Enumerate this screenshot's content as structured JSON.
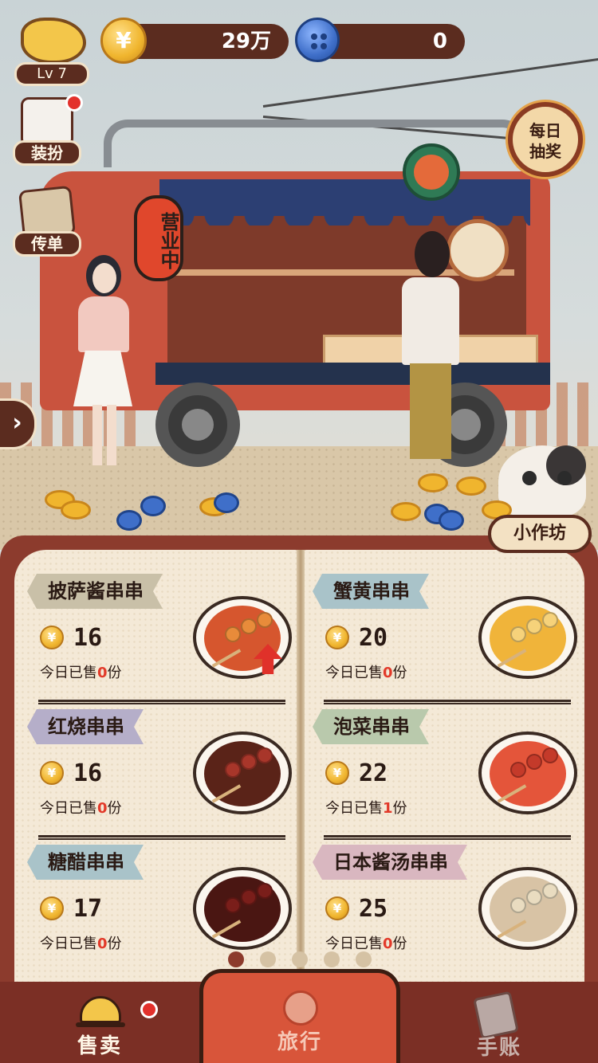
{
  "hud": {
    "level": "Lv 7",
    "coin_symbol": "¥",
    "coins": "29万",
    "buttons": "0"
  },
  "side": {
    "dress_up": "装扮",
    "flyer": "传单",
    "daily_lottery_line1": "每日",
    "daily_lottery_line2": "抽奖",
    "expand_arrow": "›"
  },
  "scene": {
    "lantern_text": "营业中"
  },
  "workshop": "小作坊",
  "menu": {
    "sold_prefix": "今日已售",
    "sold_suffix": "份",
    "left": [
      {
        "name": "披萨酱串串",
        "price": "16",
        "sold": "0",
        "tag_color": "#c9c0a8",
        "food_color": "#d6562e",
        "ball_color": "#e88b3a",
        "upgrade": true
      },
      {
        "name": "红烧串串",
        "price": "16",
        "sold": "0",
        "tag_color": "#b5aec9",
        "food_color": "#5a2318",
        "ball_color": "#a8362a",
        "upgrade": false
      },
      {
        "name": "糖醋串串",
        "price": "17",
        "sold": "0",
        "tag_color": "#a9c3c9",
        "food_color": "#4a1612",
        "ball_color": "#7a1e1a",
        "upgrade": false
      }
    ],
    "right": [
      {
        "name": "蟹黄串串",
        "price": "20",
        "sold": "0",
        "tag_color": "#a9c3c9",
        "food_color": "#f0b43a",
        "ball_color": "#f6d27a",
        "upgrade": false
      },
      {
        "name": "泡菜串串",
        "price": "22",
        "sold": "1",
        "tag_color": "#b9c9ac",
        "food_color": "#e4553a",
        "ball_color": "#c43a2a",
        "upgrade": false
      },
      {
        "name": "日本酱汤串串",
        "price": "25",
        "sold": "0",
        "tag_color": "#d9b7c0",
        "food_color": "#d8c3a5",
        "ball_color": "#e9dcc0",
        "upgrade": false
      }
    ],
    "page_dots": 5,
    "current_page": 1
  },
  "nav": {
    "sell": "售卖",
    "travel": "旅行",
    "ledger": "手账"
  }
}
